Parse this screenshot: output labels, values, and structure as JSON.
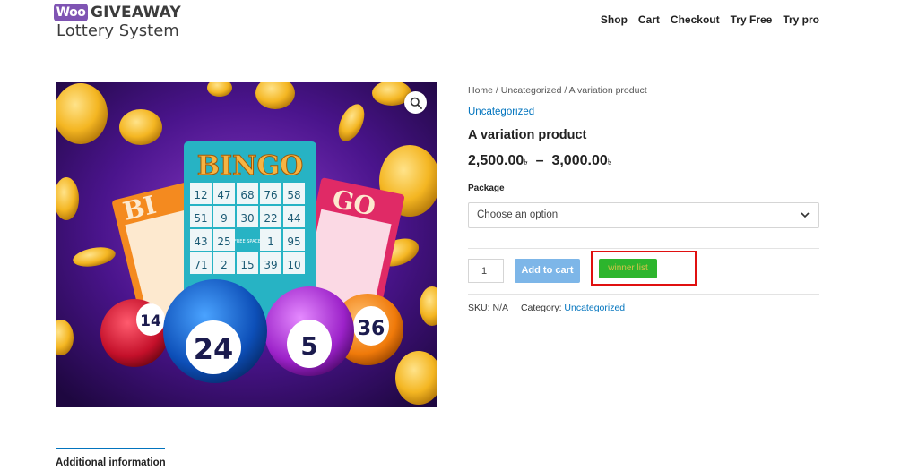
{
  "header": {
    "logo_badge": "Woo",
    "logo_title": "GIVEAWAY",
    "logo_subtitle": "Lottery System",
    "nav": [
      "Shop",
      "Cart",
      "Checkout",
      "Try Free",
      "Try pro"
    ]
  },
  "product_image": {
    "alt_text": "BINGO",
    "card_numbers": [
      "12",
      "47",
      "68",
      "76",
      "58",
      "51",
      "9",
      "30",
      "22",
      "44",
      "43",
      "25",
      "FREE SPACE",
      "1",
      "95",
      "71",
      "2",
      "15",
      "39",
      "10"
    ],
    "balls": [
      "14",
      "24",
      "5",
      "36"
    ],
    "zoom_icon": "magnifier-icon"
  },
  "summary": {
    "breadcrumb": "Home / Uncategorized / A variation product",
    "category_link": "Uncategorized",
    "title": "A variation product",
    "price_low": "2,500.00",
    "price_high": "3,000.00",
    "currency_symbol": "৳",
    "price_separator": "–",
    "package_label": "Package",
    "select_placeholder": "Choose an option",
    "quantity": "1",
    "add_to_cart_label": "Add to cart",
    "winner_list_label": "winner list",
    "sku_label": "SKU:",
    "sku_value": "N/A",
    "category_label": "Category:",
    "category_value": "Uncategorized"
  },
  "tabs": {
    "active": "Additional information"
  },
  "colors": {
    "link": "#0274be",
    "add_to_cart": "#7db6e8",
    "winner_button": "#2db52d",
    "highlight_box": "#e01010",
    "logo_badge": "#7f54b3"
  }
}
